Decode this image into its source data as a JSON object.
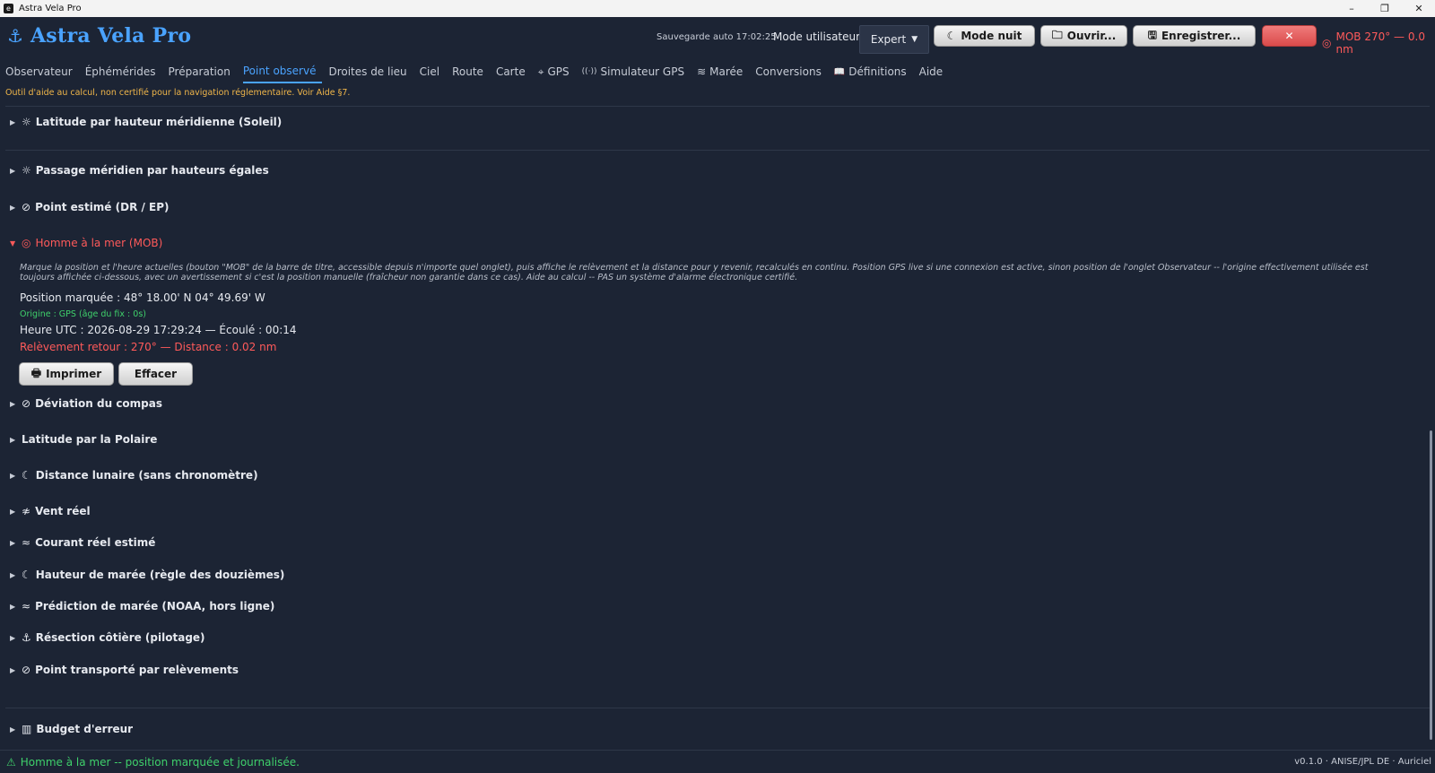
{
  "window": {
    "title": "Astra Vela Pro",
    "icon": "e",
    "controls": {
      "minimize": "–",
      "restore": "❐",
      "close": "✕"
    }
  },
  "header": {
    "app_name": "Astra Vela Pro",
    "autosave": "Sauvegarde auto 17:02:25",
    "user_mode_label": "Mode utilisateur :",
    "user_mode_value": "Expert",
    "night_mode_button": "Mode nuit",
    "open_button": "Ouvrir...",
    "save_button": "Enregistrer...",
    "close_button": "✕",
    "mob_indicator": "MOB 270° — 0.0 nm"
  },
  "tabs": [
    {
      "label": "Observateur",
      "icon": ""
    },
    {
      "label": "Éphémérides",
      "icon": ""
    },
    {
      "label": "Préparation",
      "icon": ""
    },
    {
      "label": "Point observé",
      "icon": "",
      "active": true
    },
    {
      "label": "Droites de lieu",
      "icon": ""
    },
    {
      "label": "Ciel",
      "icon": ""
    },
    {
      "label": "Route",
      "icon": ""
    },
    {
      "label": "Carte",
      "icon": ""
    },
    {
      "label": "GPS",
      "icon": "⌖"
    },
    {
      "label": "Simulateur GPS",
      "icon": "((·))"
    },
    {
      "label": "Marée",
      "icon": "≋"
    },
    {
      "label": "Conversions",
      "icon": ""
    },
    {
      "label": "Définitions",
      "icon": "📖"
    },
    {
      "label": "Aide",
      "icon": ""
    }
  ],
  "disclaimer": "Outil d'aide au calcul, non certifié pour la navigation réglementaire. Voir Aide §7.",
  "sections": [
    {
      "label": "Latitude par hauteur méridienne (Soleil)",
      "icon": "☼"
    },
    {
      "label": "Passage méridien par hauteurs égales",
      "icon": "☼"
    },
    {
      "label": "Point estimé (DR / EP)",
      "icon": "⊘"
    },
    {
      "label": "Homme à la mer (MOB)",
      "icon": "◎",
      "open": true
    },
    {
      "label": "Déviation du compas",
      "icon": "⊘"
    },
    {
      "label": "Latitude par la Polaire",
      "icon": ""
    },
    {
      "label": "Distance lunaire (sans chronomètre)",
      "icon": "☾"
    },
    {
      "label": "Vent réel",
      "icon": "≉"
    },
    {
      "label": "Courant réel estimé",
      "icon": "≈"
    },
    {
      "label": "Hauteur de marée (règle des douzièmes)",
      "icon": "☾"
    },
    {
      "label": "Prédiction de marée (NOAA, hors ligne)",
      "icon": "≈"
    },
    {
      "label": "Résection côtière (pilotage)",
      "icon": "⚓"
    },
    {
      "label": "Point transporté par relèvements",
      "icon": "⊘"
    },
    {
      "label": "Budget d'erreur",
      "icon": "▥"
    }
  ],
  "mob": {
    "description": "Marque la position et l'heure actuelles (bouton \"MOB\" de la barre de titre, accessible depuis n'importe quel onglet), puis affiche le relèvement et la distance pour y revenir, recalculés en continu. Position GPS live si une connexion est active, sinon position de l'onglet Observateur -- l'origine effectivement utilisée est toujours affichée ci-dessous, avec un avertissement si c'est la position manuelle (fraîcheur non garantie dans ce cas). Aide au calcul -- PAS un système d'alarme électronique certifié.",
    "position": "Position marquée : 48° 18.00' N   04° 49.69' W",
    "origin": "Origine : GPS (âge du fix : 0s)",
    "time": "Heure UTC : 2026-08-29 17:29:24   —   Écoulé : 00:14",
    "bearing": "Relèvement retour : 270°   —   Distance : 0.02 nm",
    "print_button": "Imprimer",
    "clear_button": "Effacer"
  },
  "status": {
    "message": "Homme à la mer -- position marquée et journalisée.",
    "version": "v0.1.0 · ANISE/JPL DE · Auriciel"
  },
  "colors": {
    "accent": "#4aa3ff",
    "alert": "#ff5a5a",
    "ok": "#3fd16b",
    "warning": "#f0b64a",
    "background": "#1c2434"
  }
}
